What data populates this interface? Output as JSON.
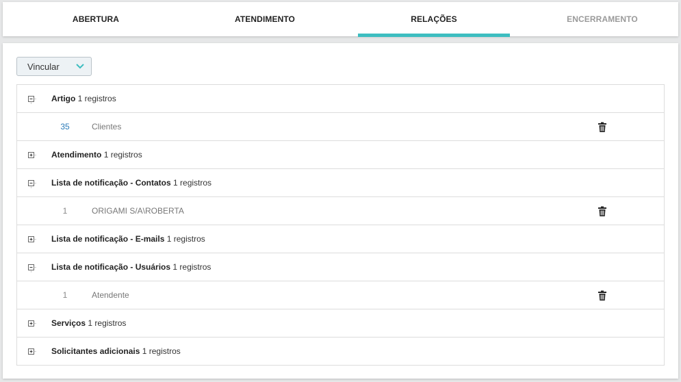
{
  "tabs": [
    {
      "label": "ABERTURA"
    },
    {
      "label": "ATENDIMENTO"
    },
    {
      "label": "RELAÇÕES"
    },
    {
      "label": "ENCERRAMENTO"
    }
  ],
  "active_tab": "RELAÇÕES",
  "toolbar": {
    "vincular_label": "Vincular"
  },
  "groups": [
    {
      "name": "Artigo",
      "count": "1 registros",
      "expanded": true,
      "item": {
        "id": "35",
        "label": "Clientes"
      }
    },
    {
      "name": "Atendimento",
      "count": "1 registros",
      "expanded": false
    },
    {
      "name": "Lista de notificação - Contatos",
      "count": "1 registros",
      "expanded": true,
      "item": {
        "id": "1",
        "label": "ORIGAMI S/A\\ROBERTA"
      }
    },
    {
      "name": "Lista de notificação - E-mails",
      "count": "1 registros",
      "expanded": false
    },
    {
      "name": "Lista de notificação - Usuários",
      "count": "1 registros",
      "expanded": true,
      "item": {
        "id": "1",
        "label": "Atendente"
      }
    },
    {
      "name": "Serviços",
      "count": "1 registros",
      "expanded": false
    },
    {
      "name": "Solicitantes adicionais",
      "count": "1 registros",
      "expanded": false
    }
  ],
  "colors": {
    "accent": "#3dbdc0",
    "link": "#2a7ab8"
  },
  "icons": {
    "expanded": "minus-box-icon",
    "collapsed": "plus-box-icon",
    "remove": "trash-icon",
    "dropdown": "chevron-down-icon"
  }
}
